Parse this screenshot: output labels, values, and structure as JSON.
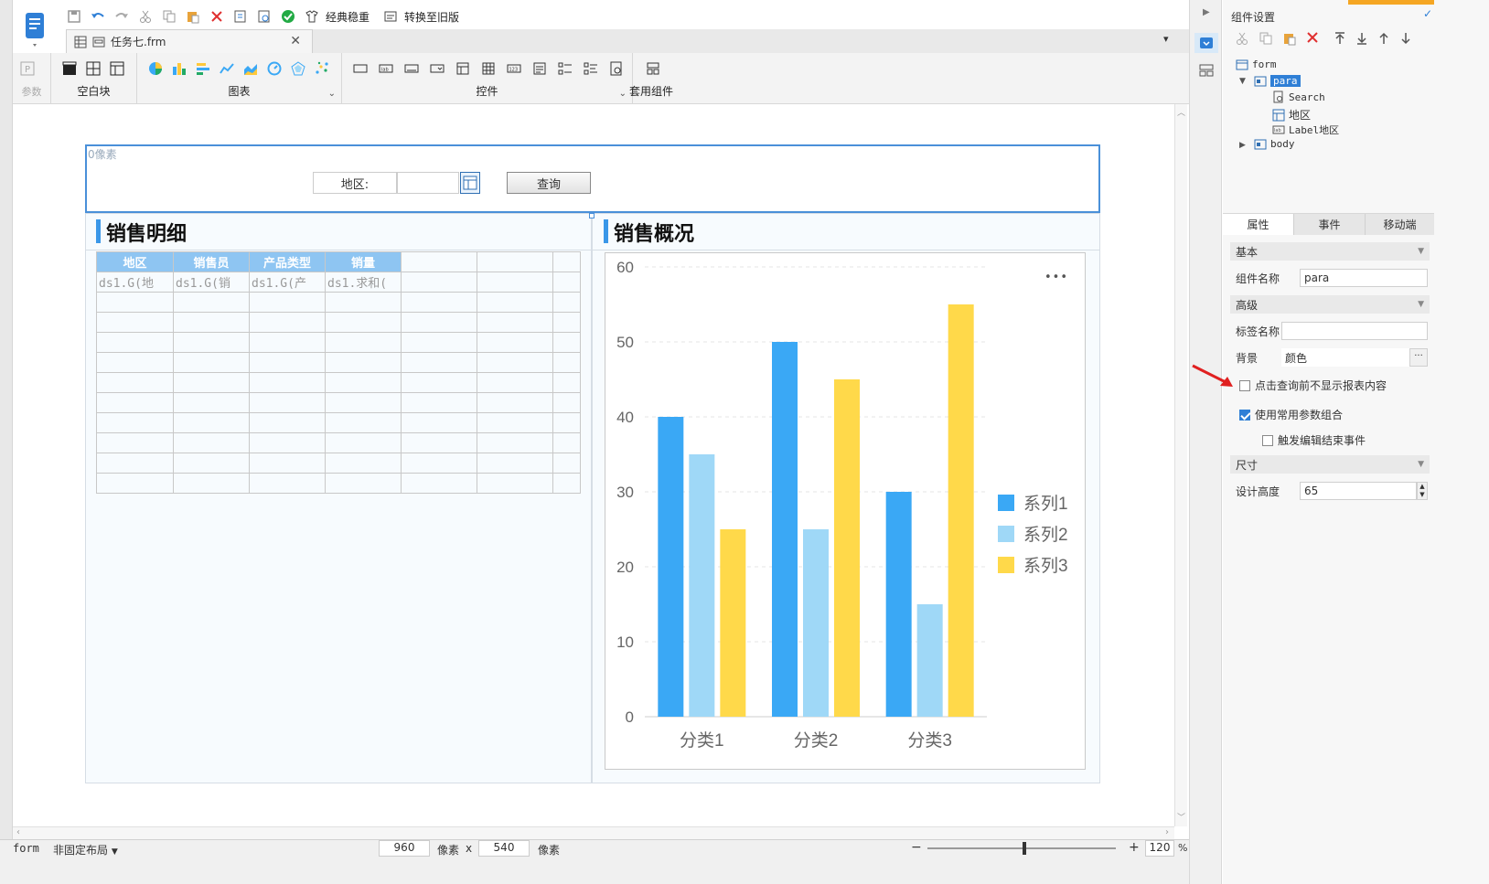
{
  "toolbar": {
    "classic_label": "经典稳重",
    "convert_label": "转换至旧版"
  },
  "tab": {
    "title": "任务七.frm"
  },
  "ribbon": {
    "param_label": "参数",
    "blank_label": "空白块",
    "chart_label": "图表",
    "widget_label": "控件",
    "component_label": "套用组件"
  },
  "para": {
    "px_label": "0像素",
    "region_label": "地区:",
    "query_button": "查询"
  },
  "detail": {
    "title": "销售明细",
    "headers": [
      "地区",
      "销售员",
      "产品类型",
      "销量"
    ],
    "row1": [
      "ds1.G(地",
      "ds1.G(销",
      "ds1.G(产",
      "ds1.求和("
    ]
  },
  "overview": {
    "title": "销售概况",
    "more": "•••"
  },
  "chart_data": {
    "type": "bar",
    "categories": [
      "分类1",
      "分类2",
      "分类3"
    ],
    "series": [
      {
        "name": "系列1",
        "values": [
          40,
          50,
          30
        ],
        "color": "#3aa8f5"
      },
      {
        "name": "系列2",
        "values": [
          35,
          25,
          15
        ],
        "color": "#9fd8f7"
      },
      {
        "name": "系列3",
        "values": [
          25,
          45,
          55
        ],
        "color": "#ffd94a"
      }
    ],
    "ylim": [
      0,
      60
    ],
    "yticks": [
      "0",
      "10",
      "20",
      "30",
      "40",
      "50",
      "60"
    ],
    "legend": "right",
    "grid": true
  },
  "statusbar": {
    "form_label": "form",
    "layout_label": "非固定布局",
    "width": "960",
    "unit1": "像素",
    "x": "x",
    "height": "540",
    "unit2": "像素",
    "zoom": "120",
    "percent": "%"
  },
  "panel": {
    "title": "组件设置",
    "tree": {
      "form": "form",
      "para": "para",
      "search": "Search",
      "region": "地区",
      "label_region": "Label地区",
      "body": "body"
    },
    "tabs": [
      "属性",
      "事件",
      "移动端"
    ],
    "basic": "基本",
    "name_label": "组件名称",
    "name_value": "para",
    "advanced": "高级",
    "tag_label": "标签名称",
    "bg_label": "背景",
    "bg_value": "颜色",
    "cb1": "点击查询前不显示报表内容",
    "cb2": "使用常用参数组合",
    "cb3": "触发编辑结束事件",
    "size": "尺寸",
    "height_label": "设计高度",
    "height_value": "65"
  }
}
